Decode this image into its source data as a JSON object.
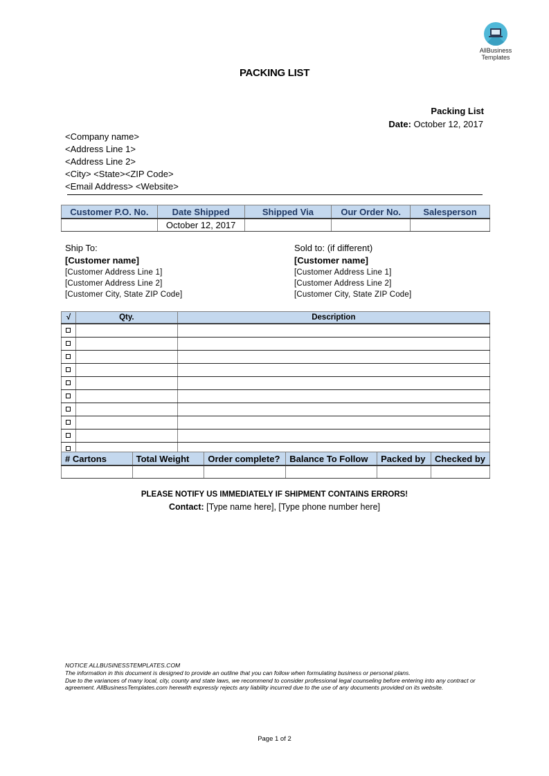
{
  "logo": {
    "line1": "AllBusiness",
    "line2": "Templates",
    "icon": "laptop-icon",
    "color": "#4fb8d8"
  },
  "document": {
    "title": "PACKING LIST",
    "label": "Packing List",
    "date_label": "Date:",
    "date_value": "October 12, 2017"
  },
  "company": {
    "lines": [
      "<Company name>",
      "<Address Line 1>",
      "<Address Line 2>",
      "<City> <State><ZIP Code>",
      "<Email Address> <Website>"
    ]
  },
  "order_table": {
    "headers": [
      "Customer P.O. No.",
      "Date Shipped",
      "Shipped Via",
      "Our Order No.",
      "Salesperson"
    ],
    "row": [
      "",
      "October 12, 2017",
      "",
      "",
      ""
    ]
  },
  "ship_to": {
    "heading": "Ship To:",
    "name": "[Customer name]",
    "address1": "[Customer Address Line 1]",
    "address2": "[Customer Address Line 2]",
    "city": "[Customer City, State ZIP Code]"
  },
  "sold_to": {
    "heading": "Sold to: (if different)",
    "name": "[Customer name]",
    "address1": "[Customer Address Line 1]",
    "address2": "[Customer Address Line 2]",
    "city": "[Customer City, State ZIP Code]"
  },
  "items_table": {
    "headers": [
      "√",
      "Qty.",
      "Description"
    ],
    "rows": [
      {
        "checked": false,
        "qty": "",
        "description": ""
      },
      {
        "checked": false,
        "qty": "",
        "description": ""
      },
      {
        "checked": false,
        "qty": "",
        "description": ""
      },
      {
        "checked": false,
        "qty": "",
        "description": ""
      },
      {
        "checked": false,
        "qty": "",
        "description": ""
      },
      {
        "checked": false,
        "qty": "",
        "description": ""
      },
      {
        "checked": false,
        "qty": "",
        "description": ""
      },
      {
        "checked": false,
        "qty": "",
        "description": ""
      },
      {
        "checked": false,
        "qty": "",
        "description": ""
      },
      {
        "checked": false,
        "qty": "",
        "description": ""
      }
    ]
  },
  "summary_table": {
    "headers": [
      "# Cartons",
      "Total Weight",
      "Order complete?",
      "Balance To Follow",
      "Packed by",
      "Checked by"
    ],
    "row": [
      "",
      "",
      "",
      "",
      "",
      ""
    ]
  },
  "footer": {
    "notify": "PLEASE NOTIFY US IMMEDIATELY IF SHIPMENT CONTAINS ERRORS!",
    "contact_label": "Contact:",
    "contact_value": " [Type name here], [Type phone number here]"
  },
  "notice": {
    "heading": "NOTICE  ALLBUSINESSTEMPLATES.COM",
    "line1": "The information in this document is designed to provide an outline that you can follow when formulating business or personal plans.",
    "line2": "Due to the variances of many local, city, county and state laws, we recommend to consider professional legal counseling before entering into any contract or agreement. AllBusinessTemplates.com herewith expressly rejects any liability incurred due to the use of any documents provided on its website."
  },
  "page": {
    "label": "Page 1 of 2"
  },
  "colors": {
    "header_fill": "#c4d8ee",
    "header_text": "#1f3864"
  }
}
